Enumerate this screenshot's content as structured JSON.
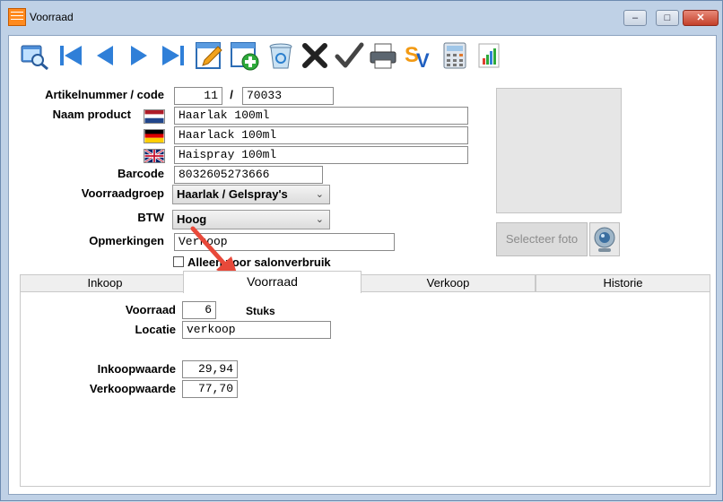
{
  "window": {
    "title": "Voorraad",
    "app_icon_text": "Salon Calc",
    "controls": {
      "minimize": "–",
      "maximize": "□",
      "close": "✕"
    }
  },
  "toolbar": {
    "buttons": [
      "zoom-search",
      "first-record",
      "previous-record",
      "next-record",
      "last-record",
      "edit",
      "add-new",
      "recycle-bin",
      "delete",
      "confirm",
      "print",
      "sv-export",
      "calculator",
      "chart"
    ],
    "sv_label": "SV"
  },
  "form": {
    "artikelnummer_label": "Artikelnummer / code",
    "artikelnummer_value": "11",
    "separator": "/",
    "code_value": "70033",
    "naam_label": "Naam product",
    "naam_nl": "Haarlak 100ml",
    "naam_de": "Haarlack 100ml",
    "naam_en": "Haispray 100ml",
    "barcode_label": "Barcode",
    "barcode_value": "8032605273666",
    "voorraadgroep_label": "Voorraadgroep",
    "voorraadgroep_value": "Haarlak / Gelspray's",
    "btw_label": "BTW",
    "btw_value": "Hoog",
    "opmerkingen_label": "Opmerkingen",
    "opmerkingen_value": "Verkoop",
    "salonverbruik_label": "Alleen voor salonverbruik",
    "salonverbruik_checked": false
  },
  "photo": {
    "select_label": "Selecteer foto"
  },
  "tabs": [
    {
      "label": "Inkoop",
      "active": false
    },
    {
      "label": "Voorraad",
      "active": true
    },
    {
      "label": "Verkoop",
      "active": false
    },
    {
      "label": "Historie",
      "active": false
    }
  ],
  "voorraad_tab": {
    "voorraad_label": "Voorraad",
    "voorraad_value": "6",
    "unit": "Stuks",
    "locatie_label": "Locatie",
    "locatie_value": "verkoop",
    "inkoopwaarde_label": "Inkoopwaarde",
    "inkoopwaarde_value": "29,94",
    "verkoopwaarde_label": "Verkoopwaarde",
    "verkoopwaarde_value": "77,70"
  },
  "colors": {
    "window_frame": "#bfd1e6",
    "annotation_arrow": "#e8493a",
    "close_button": "#c3402a"
  }
}
